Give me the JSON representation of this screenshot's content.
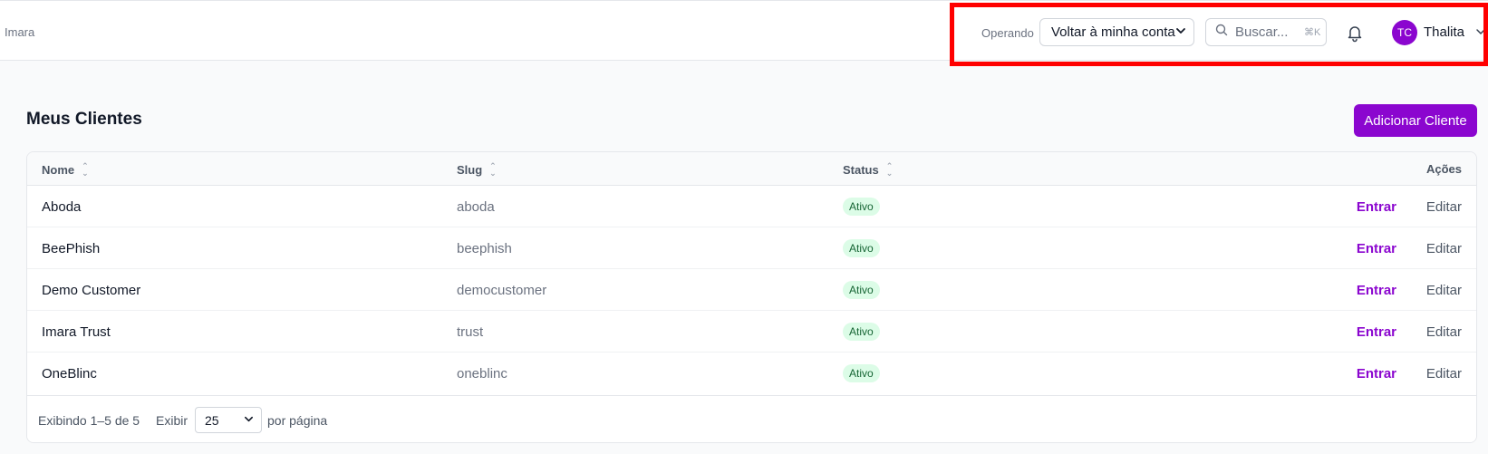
{
  "header": {
    "brand": "Imara",
    "operating_label": "Operando",
    "account_select_value": "Voltar à minha conta",
    "search_placeholder": "Buscar...",
    "search_shortcut": "⌘K",
    "user_initials": "TC",
    "user_name": "Thalita"
  },
  "page": {
    "title": "Meus Clientes",
    "add_button_label": "Adicionar Cliente"
  },
  "table": {
    "columns": {
      "name": "Nome",
      "slug": "Slug",
      "status": "Status",
      "actions": "Ações"
    },
    "rows": [
      {
        "name": "Aboda",
        "slug": "aboda",
        "status": "Ativo",
        "enter": "Entrar",
        "edit": "Editar"
      },
      {
        "name": "BeePhish",
        "slug": "beephish",
        "status": "Ativo",
        "enter": "Entrar",
        "edit": "Editar"
      },
      {
        "name": "Demo Customer",
        "slug": "democustomer",
        "status": "Ativo",
        "enter": "Entrar",
        "edit": "Editar"
      },
      {
        "name": "Imara Trust",
        "slug": "trust",
        "status": "Ativo",
        "enter": "Entrar",
        "edit": "Editar"
      },
      {
        "name": "OneBlinc",
        "slug": "oneblinc",
        "status": "Ativo",
        "enter": "Entrar",
        "edit": "Editar"
      }
    ]
  },
  "pagination": {
    "showing": "Exibindo 1–5 de 5",
    "show_label": "Exibir",
    "per_page_value": "25",
    "per_page_suffix": "por página"
  },
  "colors": {
    "accent": "#8b06cf",
    "active_badge_bg": "#dcfce7",
    "active_badge_text": "#166534",
    "highlight": "#ff0000"
  }
}
